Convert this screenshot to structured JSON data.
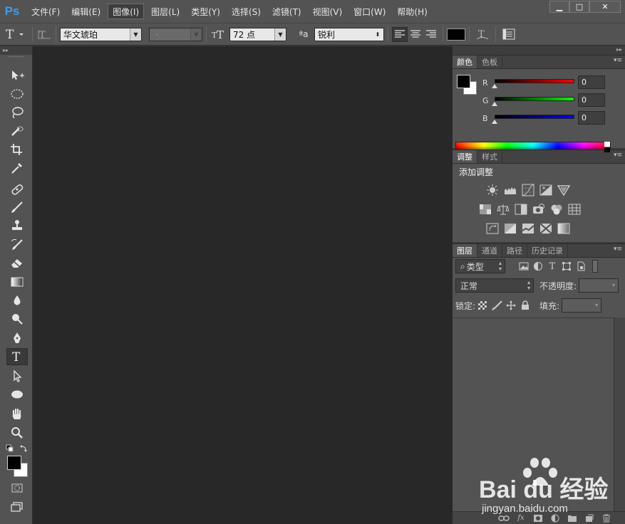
{
  "app": {
    "logo": "Ps"
  },
  "menu": [
    "文件(F)",
    "编辑(E)",
    "图像(I)",
    "图层(L)",
    "类型(Y)",
    "选择(S)",
    "滤镜(T)",
    "视图(V)",
    "窗口(W)",
    "帮助(H)"
  ],
  "menu_active_index": 2,
  "window_buttons": {
    "minimize": "▁",
    "restore": "□",
    "close": "✕"
  },
  "options": {
    "font_family": "华文琥珀",
    "font_style": "-",
    "font_size": "72 点",
    "aa_label": "ªa",
    "antialias": "锐利",
    "text_color": "#000000"
  },
  "color_panel": {
    "tabs": [
      "颜色",
      "色板"
    ],
    "sliders": [
      {
        "label": "R",
        "value": "0",
        "gradient": "linear-gradient(to right,#000,#ff0000)"
      },
      {
        "label": "G",
        "value": "0",
        "gradient": "linear-gradient(to right,#000,#00ff00)"
      },
      {
        "label": "B",
        "value": "0",
        "gradient": "linear-gradient(to right,#000,#0000ff)"
      }
    ],
    "foreground": "#000000",
    "background": "#ffffff"
  },
  "adjust_panel": {
    "tabs": [
      "调整",
      "样式"
    ],
    "title": "添加调整"
  },
  "layers_panel": {
    "tabs": [
      "图层",
      "通道",
      "路径",
      "历史记录"
    ],
    "filter_kind": "类型",
    "blend_mode": "正常",
    "opacity_label": "不透明度:",
    "lock_label": "锁定:",
    "fill_label": "填充:"
  },
  "watermark": {
    "brand": "Bai du 经验",
    "url": "jingyan.baidu.com"
  }
}
